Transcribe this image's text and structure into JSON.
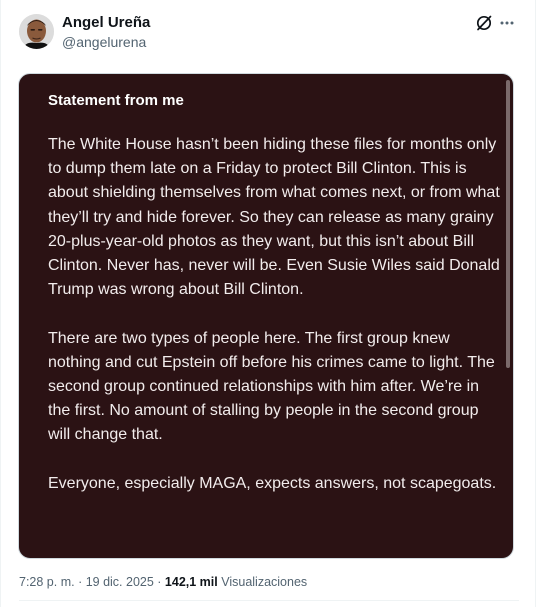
{
  "author": {
    "display_name": "Angel Ureña",
    "handle": "@angelurena"
  },
  "icons": {
    "avatar": "profile-photo",
    "grok": "grok-slash-circle-icon",
    "more": "more-horizontal-icon"
  },
  "note": {
    "title": "Statement from me",
    "paragraphs": [
      "The White House hasn’t been hiding these files for months only to dump them late on a Friday to protect Bill Clinton. This is about shielding themselves from what comes next, or from what they’ll try and hide forever. So they can release as many grainy 20-plus-year-old photos as they want, but this isn’t about Bill Clinton. Never has, never will be. Even Susie Wiles said Donald Trump was wrong about Bill Clinton.",
      "There are two types of people here. The first group knew nothing and cut Epstein off before his crimes came to light. The second group continued relationships with him after. We’re in the first. No amount of stalling by people in the second group will change that.",
      "Everyone, especially MAGA, expects answers, not scapegoats."
    ]
  },
  "meta": {
    "time": "7:28 p. m.",
    "separator": " · ",
    "date": "19 dic. 2025",
    "views_count": "142,1 mil",
    "views_label": " Visualizaciones"
  },
  "colors": {
    "note_background": "#2b1214",
    "note_text": "#f2ecec",
    "secondary_text": "#536471",
    "primary_text": "#0f1419"
  }
}
